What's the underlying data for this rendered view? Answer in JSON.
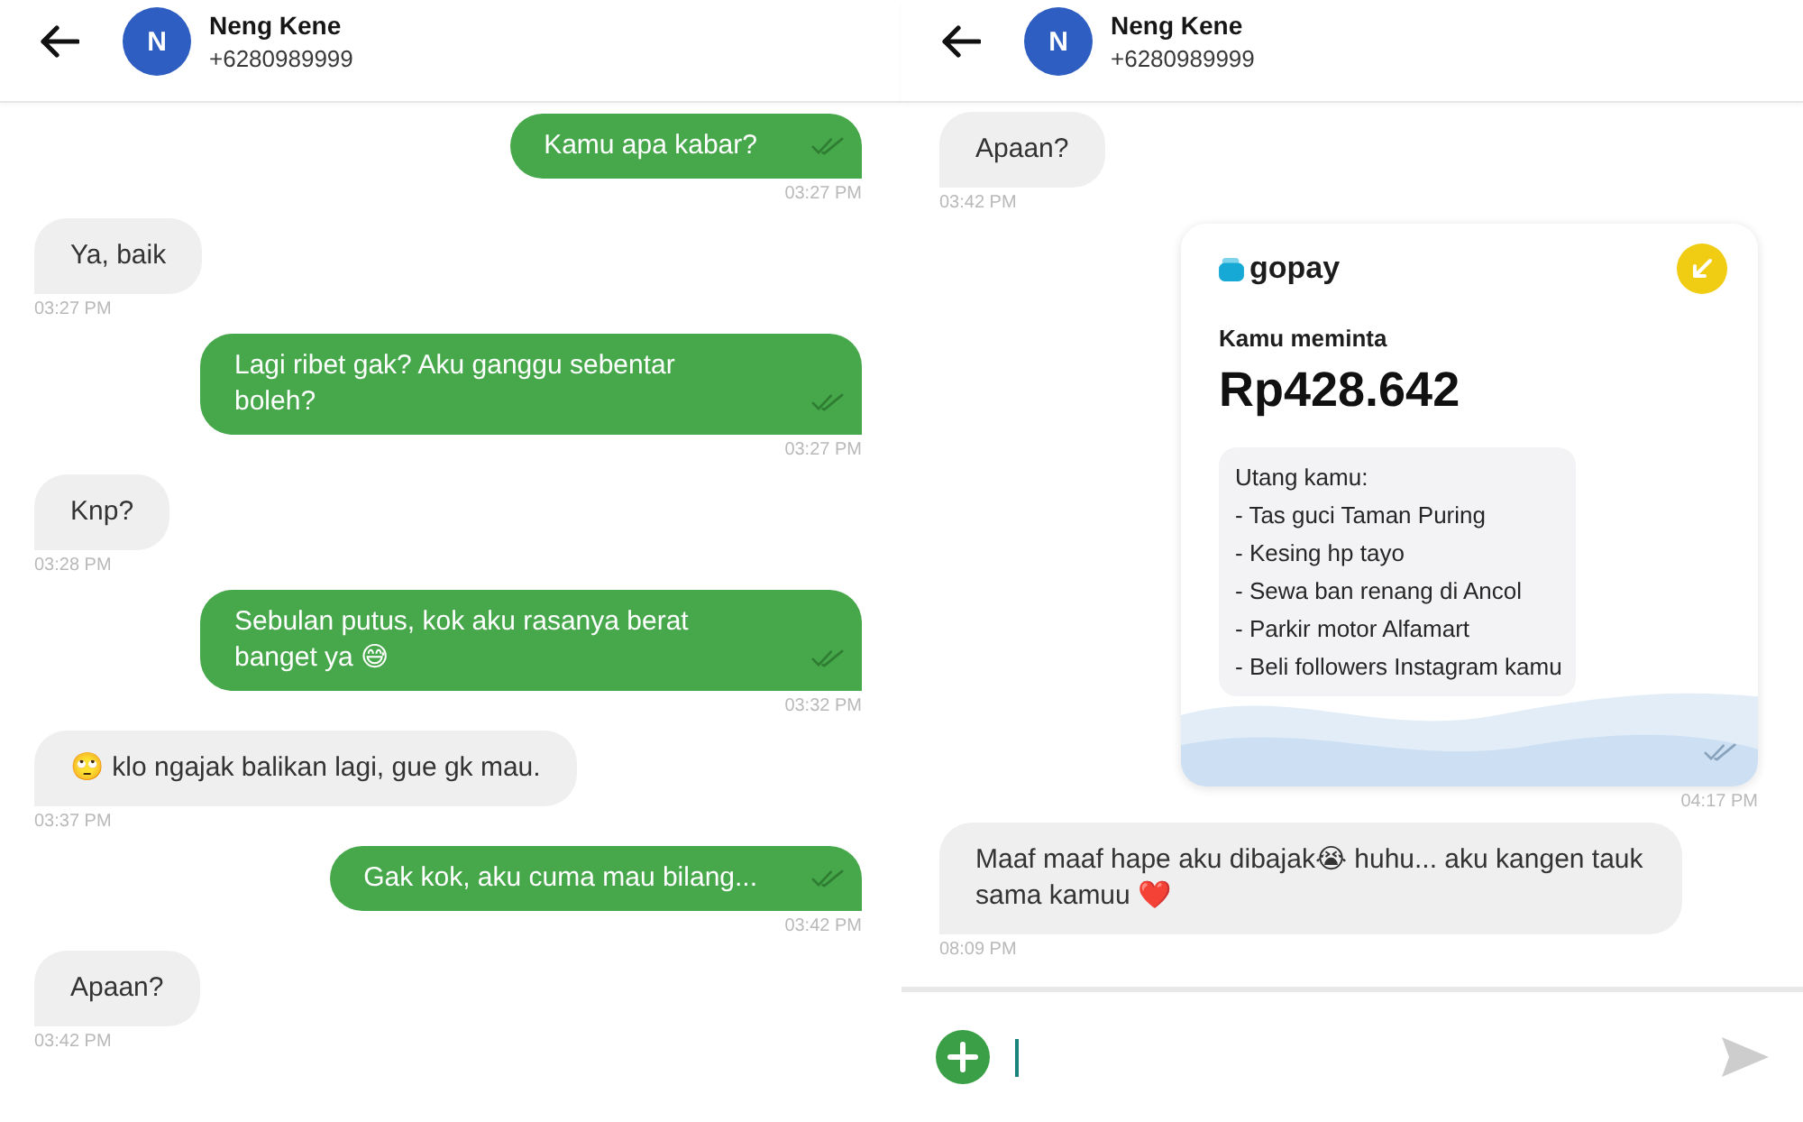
{
  "screens": [
    {
      "header": {
        "initial": "N",
        "name": "Neng Kene",
        "phone": "+6280989999"
      },
      "messages": [
        {
          "kind": "text",
          "outgoing": true,
          "text": "Kamu apa kabar?",
          "time": "03:27 PM"
        },
        {
          "kind": "text",
          "outgoing": false,
          "text": "Ya, baik",
          "time": "03:27 PM"
        },
        {
          "kind": "text",
          "outgoing": true,
          "text": "Lagi ribet gak? Aku ganggu sebentar boleh?",
          "time": "03:27 PM"
        },
        {
          "kind": "text",
          "outgoing": false,
          "text": "Knp?",
          "time": "03:28 PM"
        },
        {
          "kind": "text",
          "outgoing": true,
          "text": "Sebulan putus, kok aku rasanya berat banget ya 😅",
          "time": "03:32 PM"
        },
        {
          "kind": "text",
          "outgoing": false,
          "text": "🙄 klo ngajak balikan lagi, gue gk mau.",
          "time": "03:37 PM"
        },
        {
          "kind": "text",
          "outgoing": true,
          "text": "Gak kok, aku cuma mau bilang...",
          "time": "03:42 PM"
        },
        {
          "kind": "text",
          "outgoing": false,
          "text": "Apaan?",
          "time": "03:42 PM"
        }
      ]
    },
    {
      "header": {
        "initial": "N",
        "name": "Neng Kene",
        "phone": "+6280989999"
      },
      "messages": [
        {
          "kind": "text",
          "outgoing": false,
          "text": "Apaan?",
          "time": "03:42 PM"
        },
        {
          "kind": "payment",
          "outgoing": true,
          "brand": "gopay",
          "label": "Kamu meminta",
          "amount": "Rp428.642",
          "note_title": "Utang kamu:",
          "note_lines": [
            "- Tas guci Taman Puring",
            "- Kesing hp tayo",
            "- Sewa ban renang di Ancol",
            "- Parkir motor Alfamart",
            "- Beli followers Instagram kamu"
          ],
          "time": "04:17 PM"
        },
        {
          "kind": "text",
          "outgoing": false,
          "text": "Maaf maaf hape aku dibajak😭 huhu... aku kangen tauk sama kamuu ❤️",
          "time": "08:09 PM"
        }
      ],
      "composer": {
        "focused": true
      }
    }
  ]
}
